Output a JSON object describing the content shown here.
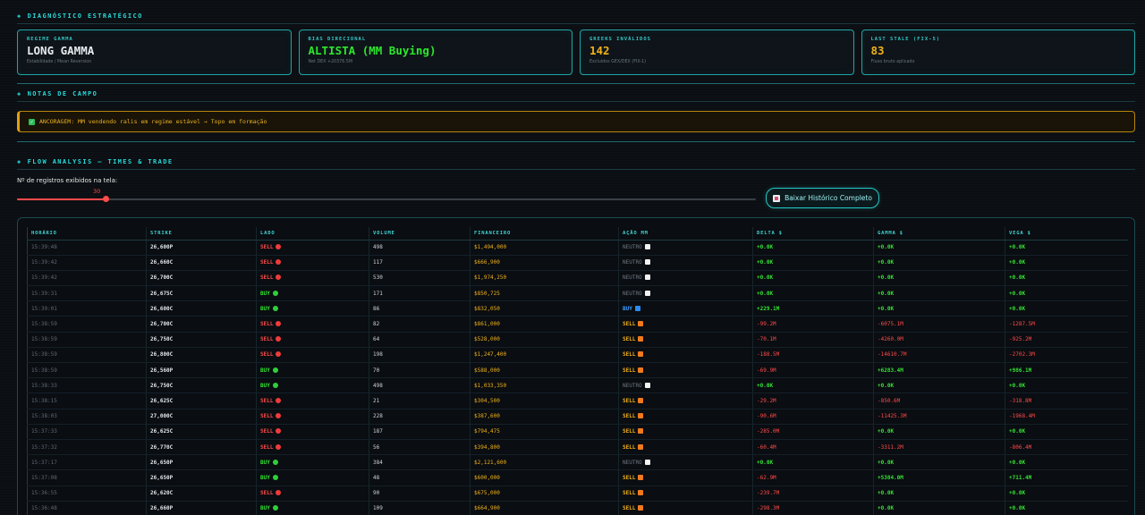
{
  "sections": {
    "diagnostic": "DIAGNÓSTICO ESTRATÉGICO",
    "notes": "NOTAS DE CAMPO",
    "flow": "FLOW ANALYSIS — TIMES & TRADE"
  },
  "cards": [
    {
      "label": "REGIME GAMMA",
      "value": "LONG GAMMA",
      "sub": "Estabilidade / Mean Reversion",
      "color": "#e6ebef"
    },
    {
      "label": "BIAS DIRECIONAL",
      "value": "ALTISTA (MM Buying)",
      "sub": "Net DEX +20376.5M",
      "color": "#2ee62e"
    },
    {
      "label": "GREEKS INVÁLIDOS",
      "value": "142",
      "sub": "Excluídos GEX/DEX (FIX-1)",
      "color": "#f0b21b"
    },
    {
      "label": "LAST STALE (FIX-5)",
      "value": "83",
      "sub": "Fluxo bruto aplicado",
      "color": "#f0b21b"
    }
  ],
  "note": {
    "text": "ANCORAGEM: MM vendendo ralis em regime estável → Topo em formação"
  },
  "slider": {
    "label": "Nº de registros exibidos na tela:",
    "value": 30,
    "min": 0,
    "max": 250
  },
  "download_button": {
    "label": "Baixar Histórico Completo"
  },
  "table": {
    "headers": [
      "HORÁRIO",
      "STRIKE",
      "LADO",
      "VOLUME",
      "FINANCEIRO",
      "AÇÃO MM",
      "DELTA $",
      "GAMMA $",
      "VEGA $"
    ],
    "rows": [
      {
        "time": "15:39:48",
        "strike": "26,600P",
        "side": "SELL",
        "volume": "498",
        "fin": "$1,494,000",
        "mm": "NEUTRO",
        "delta": "+0.0K",
        "gamma": "+0.0K",
        "vega": "+0.0K"
      },
      {
        "time": "15:39:42",
        "strike": "26,660C",
        "side": "SELL",
        "volume": "117",
        "fin": "$666,900",
        "mm": "NEUTRO",
        "delta": "+0.0K",
        "gamma": "+0.0K",
        "vega": "+0.0K"
      },
      {
        "time": "15:39:42",
        "strike": "26,700C",
        "side": "SELL",
        "volume": "530",
        "fin": "$1,974,250",
        "mm": "NEUTRO",
        "delta": "+0.0K",
        "gamma": "+0.0K",
        "vega": "+0.0K"
      },
      {
        "time": "15:39:31",
        "strike": "26,675C",
        "side": "BUY",
        "volume": "171",
        "fin": "$850,725",
        "mm": "NEUTRO",
        "delta": "+0.0K",
        "gamma": "+0.0K",
        "vega": "+0.0K"
      },
      {
        "time": "15:39:01",
        "strike": "26,600C",
        "side": "BUY",
        "volume": "86",
        "fin": "$832,050",
        "mm": "BUY",
        "delta": "+229.1M",
        "gamma": "+0.0K",
        "vega": "+0.0K"
      },
      {
        "time": "15:38:59",
        "strike": "26,700C",
        "side": "SELL",
        "volume": "82",
        "fin": "$861,000",
        "mm": "SELL",
        "delta": "-99.2M",
        "gamma": "-6075.1M",
        "vega": "-1287.5M"
      },
      {
        "time": "15:38:59",
        "strike": "26,750C",
        "side": "SELL",
        "volume": "64",
        "fin": "$528,000",
        "mm": "SELL",
        "delta": "-70.1M",
        "gamma": "-4260.0M",
        "vega": "-925.2M"
      },
      {
        "time": "15:38:59",
        "strike": "26,800C",
        "side": "SELL",
        "volume": "198",
        "fin": "$1,247,400",
        "mm": "SELL",
        "delta": "-188.5M",
        "gamma": "-14610.7M",
        "vega": "-2702.3M"
      },
      {
        "time": "15:38:59",
        "strike": "26,560P",
        "side": "BUY",
        "volume": "70",
        "fin": "$588,000",
        "mm": "SELL",
        "delta": "-69.9M",
        "gamma": "+6283.4M",
        "vega": "+986.1M"
      },
      {
        "time": "15:38:33",
        "strike": "26,750C",
        "side": "BUY",
        "volume": "498",
        "fin": "$1,033,350",
        "mm": "NEUTRO",
        "delta": "+0.0K",
        "gamma": "+0.0K",
        "vega": "+0.0K"
      },
      {
        "time": "15:38:15",
        "strike": "26,625C",
        "side": "SELL",
        "volume": "21",
        "fin": "$304,500",
        "mm": "SELL",
        "delta": "-29.2M",
        "gamma": "-850.6M",
        "vega": "-318.8M"
      },
      {
        "time": "15:38:03",
        "strike": "27,000C",
        "side": "SELL",
        "volume": "228",
        "fin": "$387,600",
        "mm": "SELL",
        "delta": "-90.6M",
        "gamma": "-11425.3M",
        "vega": "-1968.4M"
      },
      {
        "time": "15:37:33",
        "strike": "26,625C",
        "side": "SELL",
        "volume": "187",
        "fin": "$794,475",
        "mm": "SELL",
        "delta": "-285.0M",
        "gamma": "+0.0K",
        "vega": "+0.0K"
      },
      {
        "time": "15:37:32",
        "strike": "26,770C",
        "side": "SELL",
        "volume": "56",
        "fin": "$394,800",
        "mm": "SELL",
        "delta": "-60.4M",
        "gamma": "-3311.2M",
        "vega": "-806.4M"
      },
      {
        "time": "15:37:17",
        "strike": "26,650P",
        "side": "BUY",
        "volume": "384",
        "fin": "$2,121,600",
        "mm": "NEUTRO",
        "delta": "+0.0K",
        "gamma": "+0.0K",
        "vega": "+0.0K"
      },
      {
        "time": "15:37:08",
        "strike": "26,650P",
        "side": "BUY",
        "volume": "48",
        "fin": "$600,000",
        "mm": "SELL",
        "delta": "-62.9M",
        "gamma": "+5384.0M",
        "vega": "+711.4M"
      },
      {
        "time": "15:36:55",
        "strike": "26,620C",
        "side": "SELL",
        "volume": "90",
        "fin": "$675,000",
        "mm": "SELL",
        "delta": "-239.7M",
        "gamma": "+0.0K",
        "vega": "+0.0K"
      },
      {
        "time": "15:36:48",
        "strike": "26,660P",
        "side": "BUY",
        "volume": "109",
        "fin": "$664,900",
        "mm": "SELL",
        "delta": "-298.3M",
        "gamma": "+0.0K",
        "vega": "+0.0K"
      }
    ]
  },
  "colors": {
    "accent": "#29d9d9",
    "sell": "#ff4b4b",
    "buy": "#33e133",
    "money": "#f0b21b"
  }
}
